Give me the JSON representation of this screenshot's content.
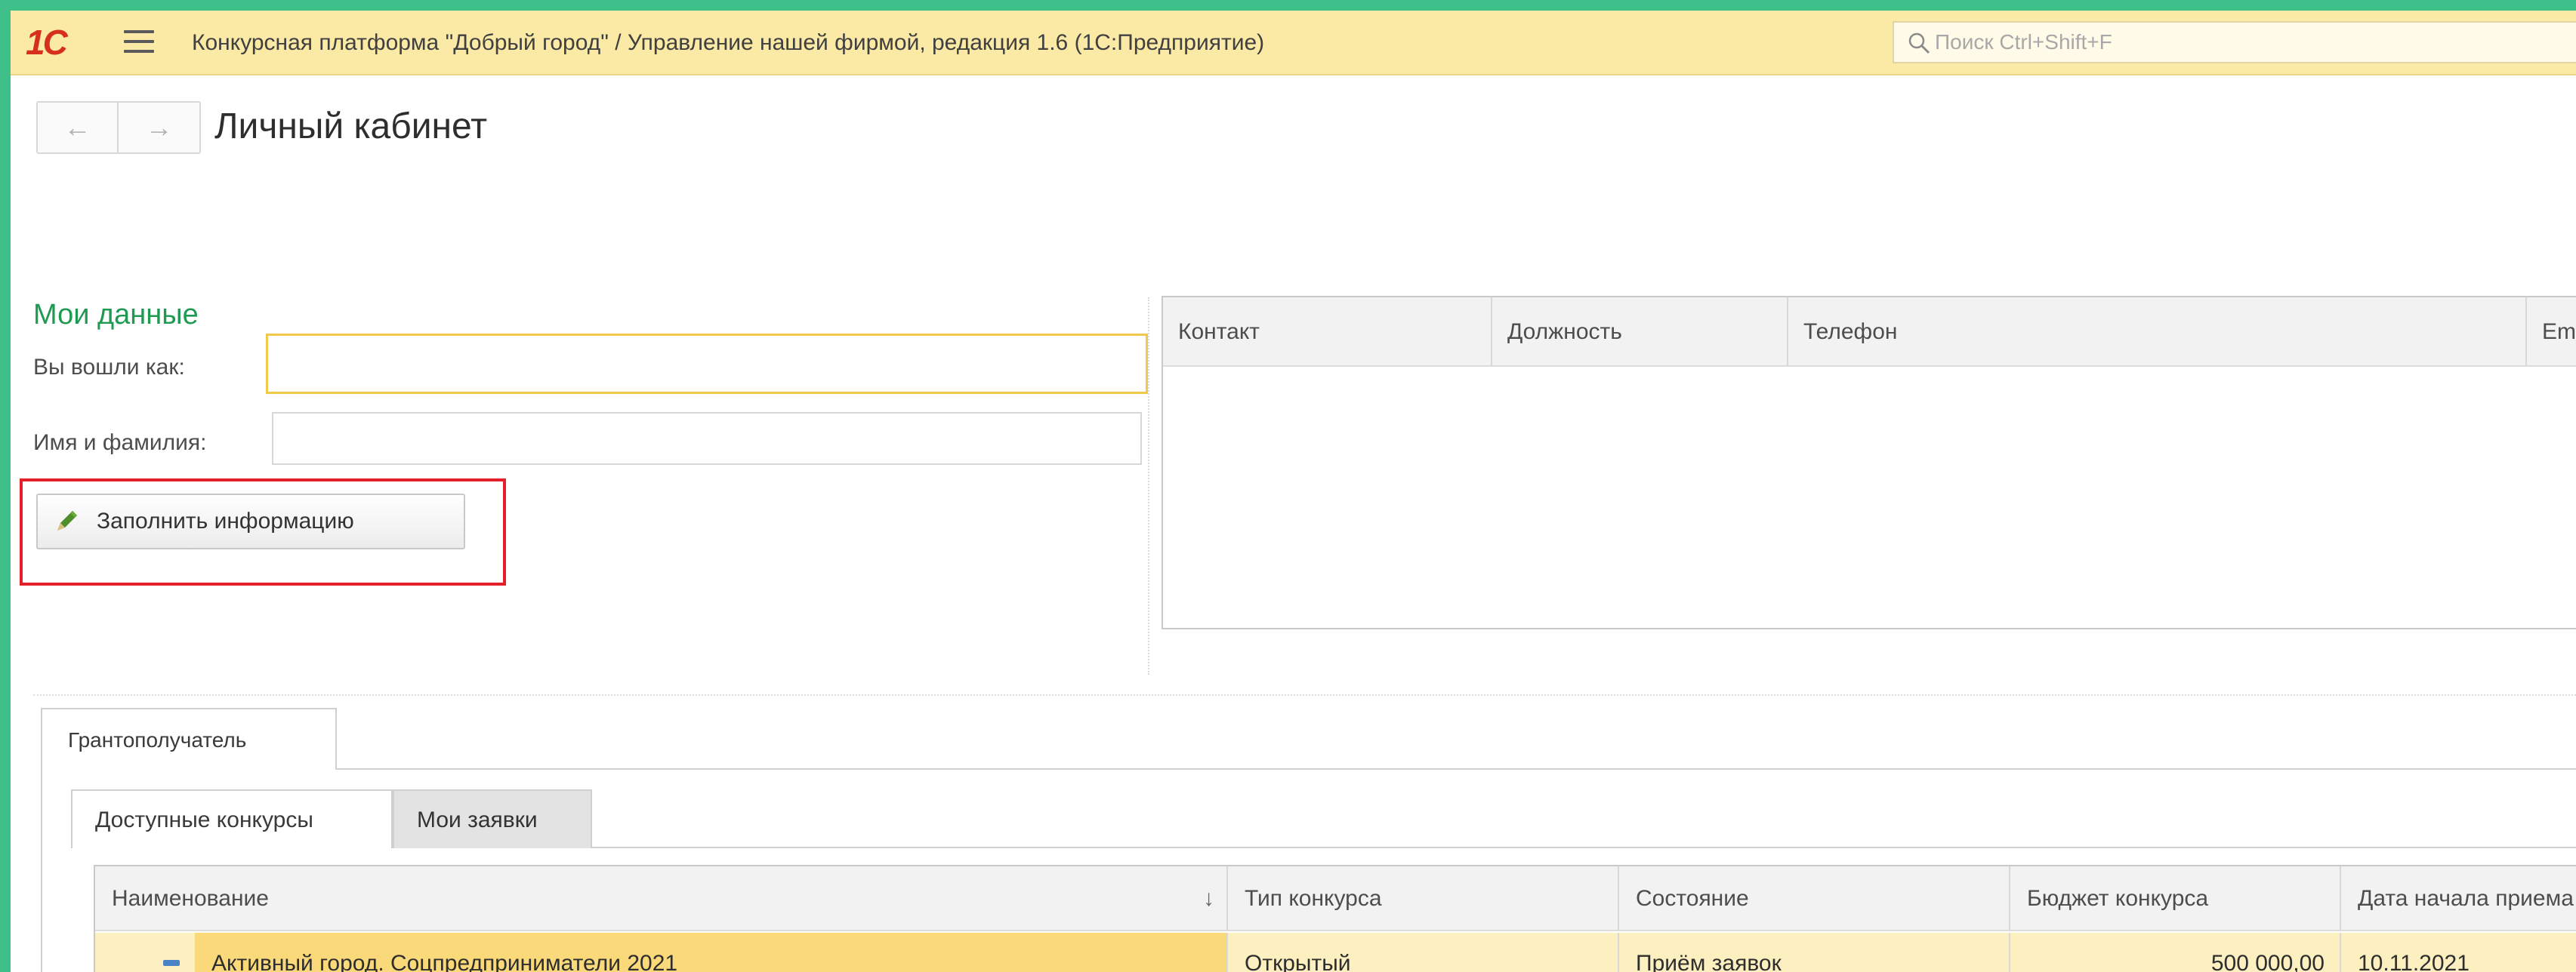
{
  "app": {
    "logo": "1С",
    "title": "Конкурсная платформа \"Добрый город\" / Управление нашей фирмой, редакция 1.6  (1С:Предприятие)",
    "search_placeholder": "Поиск Ctrl+Shift+F"
  },
  "nav": {
    "back_icon": "arrow-left-icon",
    "forward_icon": "arrow-right-icon"
  },
  "page": {
    "title": "Личный кабинет"
  },
  "my_data": {
    "section_title": "Мои данные",
    "logged_in_label": "Вы вошли как:",
    "logged_in_value": "",
    "name_label": "Имя и фамилия:",
    "name_value": "",
    "fill_button_label": "Заполнить информацию",
    "fill_button_icon": "pencil-icon"
  },
  "contacts_table": {
    "columns": [
      "Контакт",
      "Должность",
      "Телефон",
      "Email"
    ],
    "rows": []
  },
  "tabs": {
    "outer": [
      {
        "label": "Грантополучатель",
        "active": true
      }
    ],
    "inner": [
      {
        "label": "Доступные конкурсы",
        "active": true
      },
      {
        "label": "Мои заявки",
        "active": false
      }
    ]
  },
  "contests_table": {
    "columns": [
      "Наименование",
      "Тип конкурса",
      "Состояние",
      "Бюджет конкурса",
      "Дата начала приема"
    ],
    "sort_indicator": "↓",
    "rows": [
      {
        "name": "Активный город. Соцпредприниматели 2021",
        "type": "Открытый",
        "state": "Приём заявок",
        "budget": "500 000,00",
        "start_date": "10.11.2021"
      }
    ]
  },
  "colors": {
    "titlebar_bg": "#fbe9a6",
    "section_title": "#1f9a52",
    "highlight_outline": "#e3202a",
    "selected_row": "#fcefc0",
    "selected_cell": "#f9d97a",
    "frame_border": "#3fbf8a"
  }
}
